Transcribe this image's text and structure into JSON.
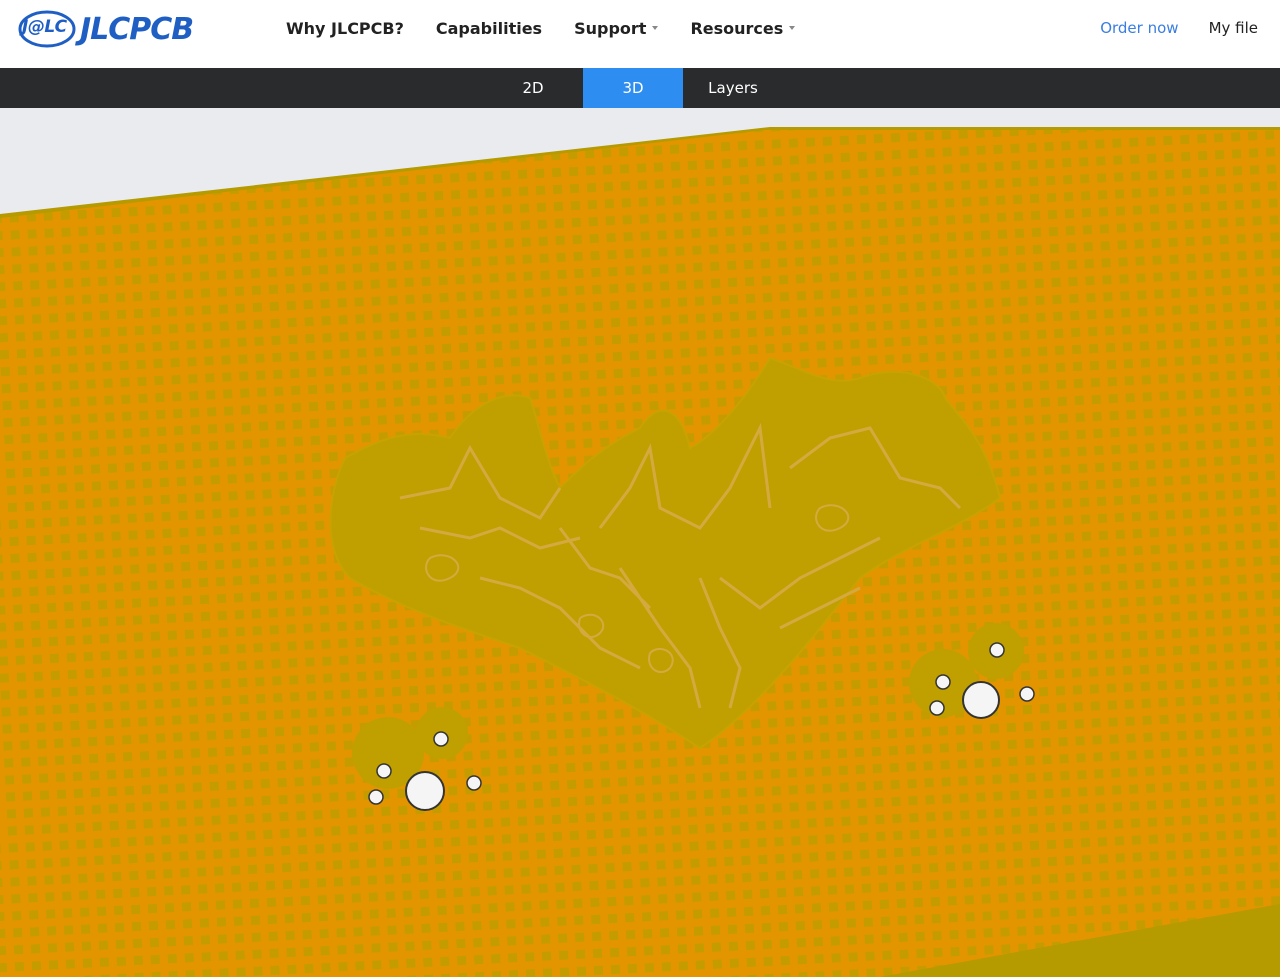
{
  "header": {
    "logo_badge": "J@LC",
    "logo_word": "JLCPCB",
    "nav": [
      {
        "label": "Why JLCPCB?",
        "dropdown": false
      },
      {
        "label": "Capabilities",
        "dropdown": false
      },
      {
        "label": "Support",
        "dropdown": true
      },
      {
        "label": "Resources",
        "dropdown": true
      }
    ],
    "order_now": "Order now",
    "my_file": "My file"
  },
  "view_tabs": {
    "items": [
      "2D",
      "3D",
      "Layers"
    ],
    "active": "3D"
  },
  "viewer": {
    "board_color": "#e39500",
    "pattern_color": "#c0a000",
    "background": "#e9ebef"
  },
  "colors": {
    "brand": "#1f5fc4",
    "accent": "#2e8df0",
    "link": "#3a7ee0"
  }
}
